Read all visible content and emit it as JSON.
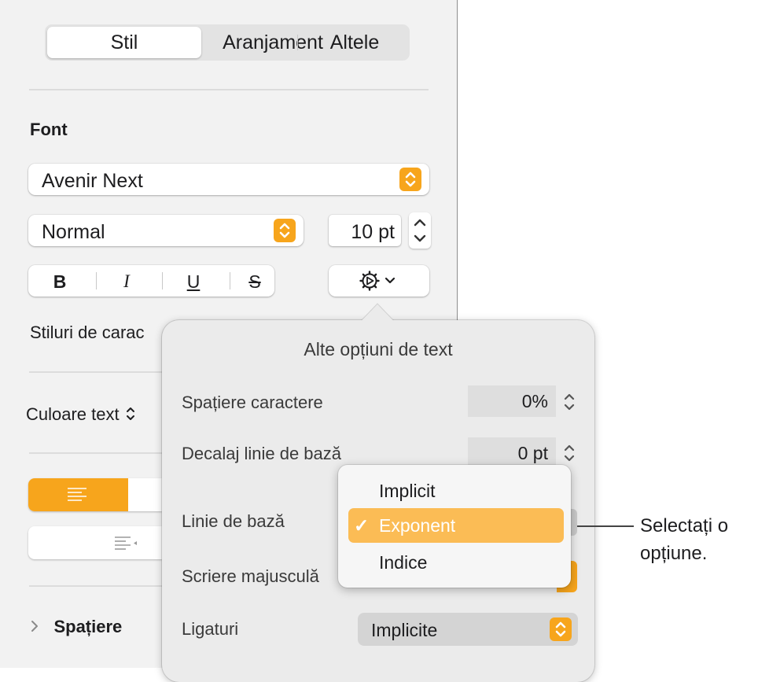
{
  "tabs": [
    {
      "label": "Stil",
      "active": true
    },
    {
      "label": "Aranjament",
      "active": false
    },
    {
      "label": "Altele",
      "active": false
    }
  ],
  "font": {
    "section_label": "Font",
    "family": "Avenir Next",
    "typeface": "Normal",
    "size": "10 pt"
  },
  "format": {
    "bold": "B",
    "italic": "I",
    "underline": "U",
    "strikethrough": "S"
  },
  "char_styles_label": "Stiluri de carac",
  "text_color_label": "Culoare text",
  "spacing_label": "Spațiere",
  "popover": {
    "title": "Alte opțiuni de text",
    "char_spacing_label": "Spațiere caractere",
    "char_spacing_value": "0%",
    "baseline_shift_label": "Decalaj linie de bază",
    "baseline_shift_value": "0 pt",
    "baseline_label": "Linie de bază",
    "capitalization_label": "Scriere majusculă",
    "ligatures_label": "Ligaturi",
    "ligatures_value": "Implicite"
  },
  "baseline_menu": {
    "items": [
      "Implicit",
      "Exponent",
      "Indice"
    ],
    "selected": "Exponent",
    "checkmark": "✓"
  },
  "callout": {
    "line1": "Selectați o",
    "line2": "opțiune."
  },
  "colors": {
    "accent": "#f7a51c",
    "highlight": "#fbbc55",
    "align_active": "#f7a51c"
  },
  "icons": [
    "gear-icon",
    "chevron-down-icon",
    "updown-chevron-icon",
    "align-left-icon",
    "indent-icon",
    "disclosure-icon",
    "checkmark-icon"
  ]
}
